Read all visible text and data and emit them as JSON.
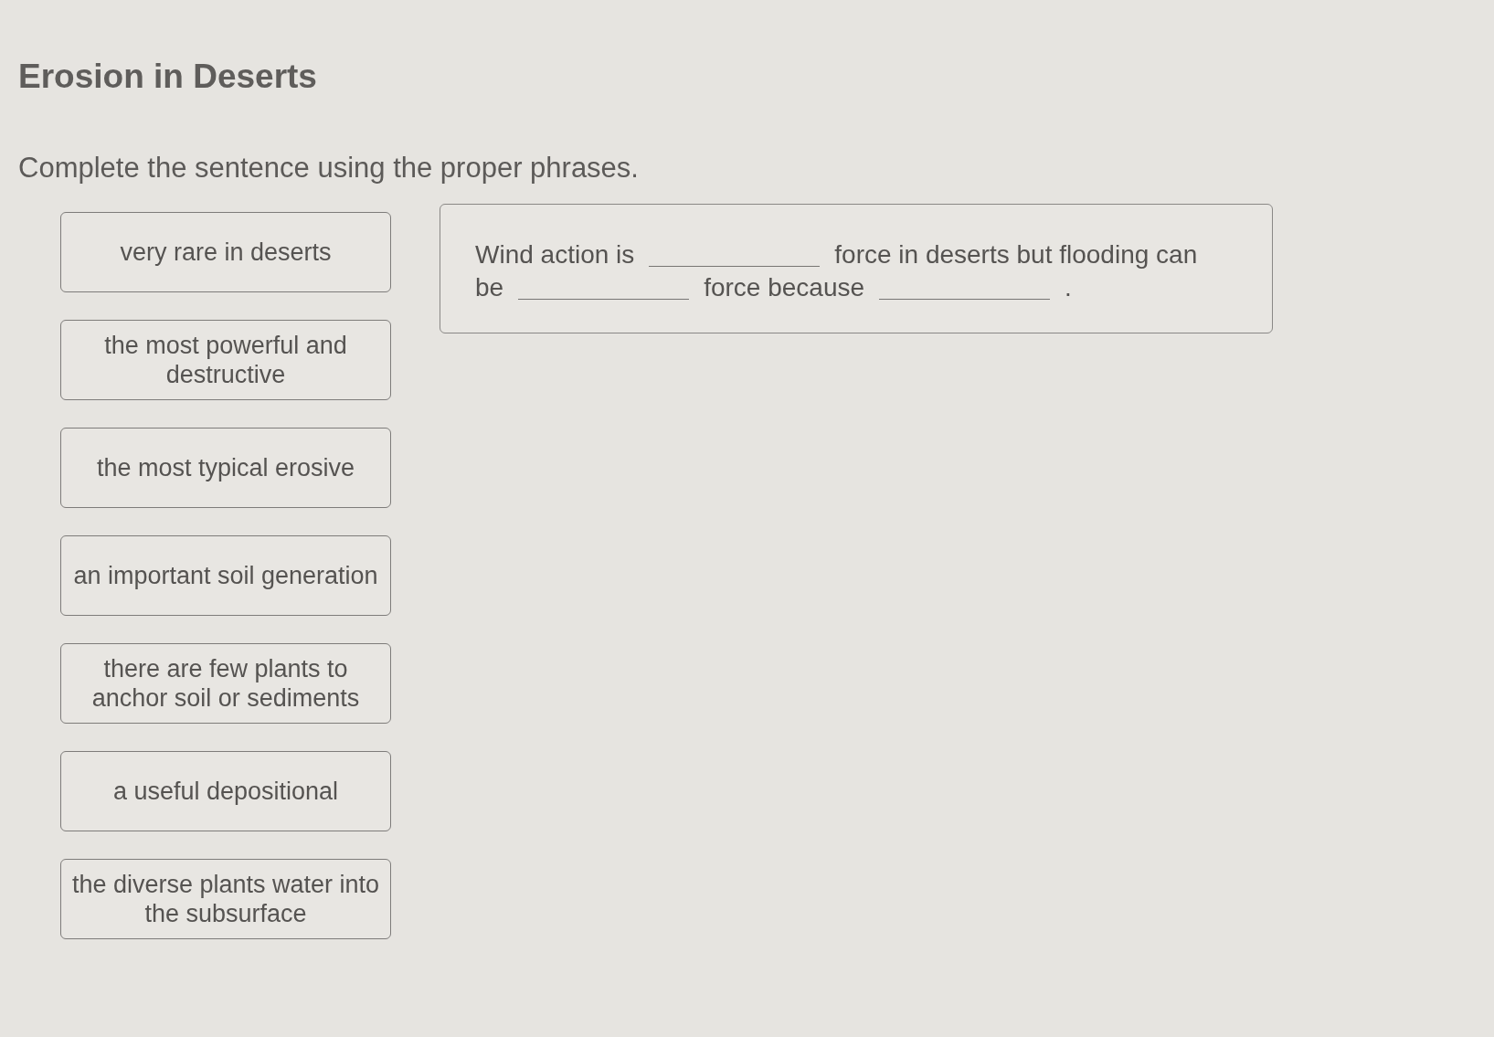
{
  "title": "Erosion in Deserts",
  "instructions": "Complete the sentence using the proper phrases.",
  "phrases": [
    "very rare in deserts",
    "the most powerful and destructive",
    "the most typical erosive",
    "an important soil generation",
    "there are few plants to anchor soil or sediments",
    "a useful depositional",
    "the diverse plants water into the subsurface"
  ],
  "sentence": {
    "lines": [
      [
        {
          "kind": "text",
          "text": "Wind action is"
        },
        {
          "kind": "blank"
        },
        {
          "kind": "text",
          "text": "force in deserts but flooding can"
        }
      ],
      [
        {
          "kind": "text",
          "text": "be"
        },
        {
          "kind": "blank"
        },
        {
          "kind": "text",
          "text": "force because"
        },
        {
          "kind": "blank"
        },
        {
          "kind": "text",
          "text": "."
        }
      ]
    ]
  }
}
